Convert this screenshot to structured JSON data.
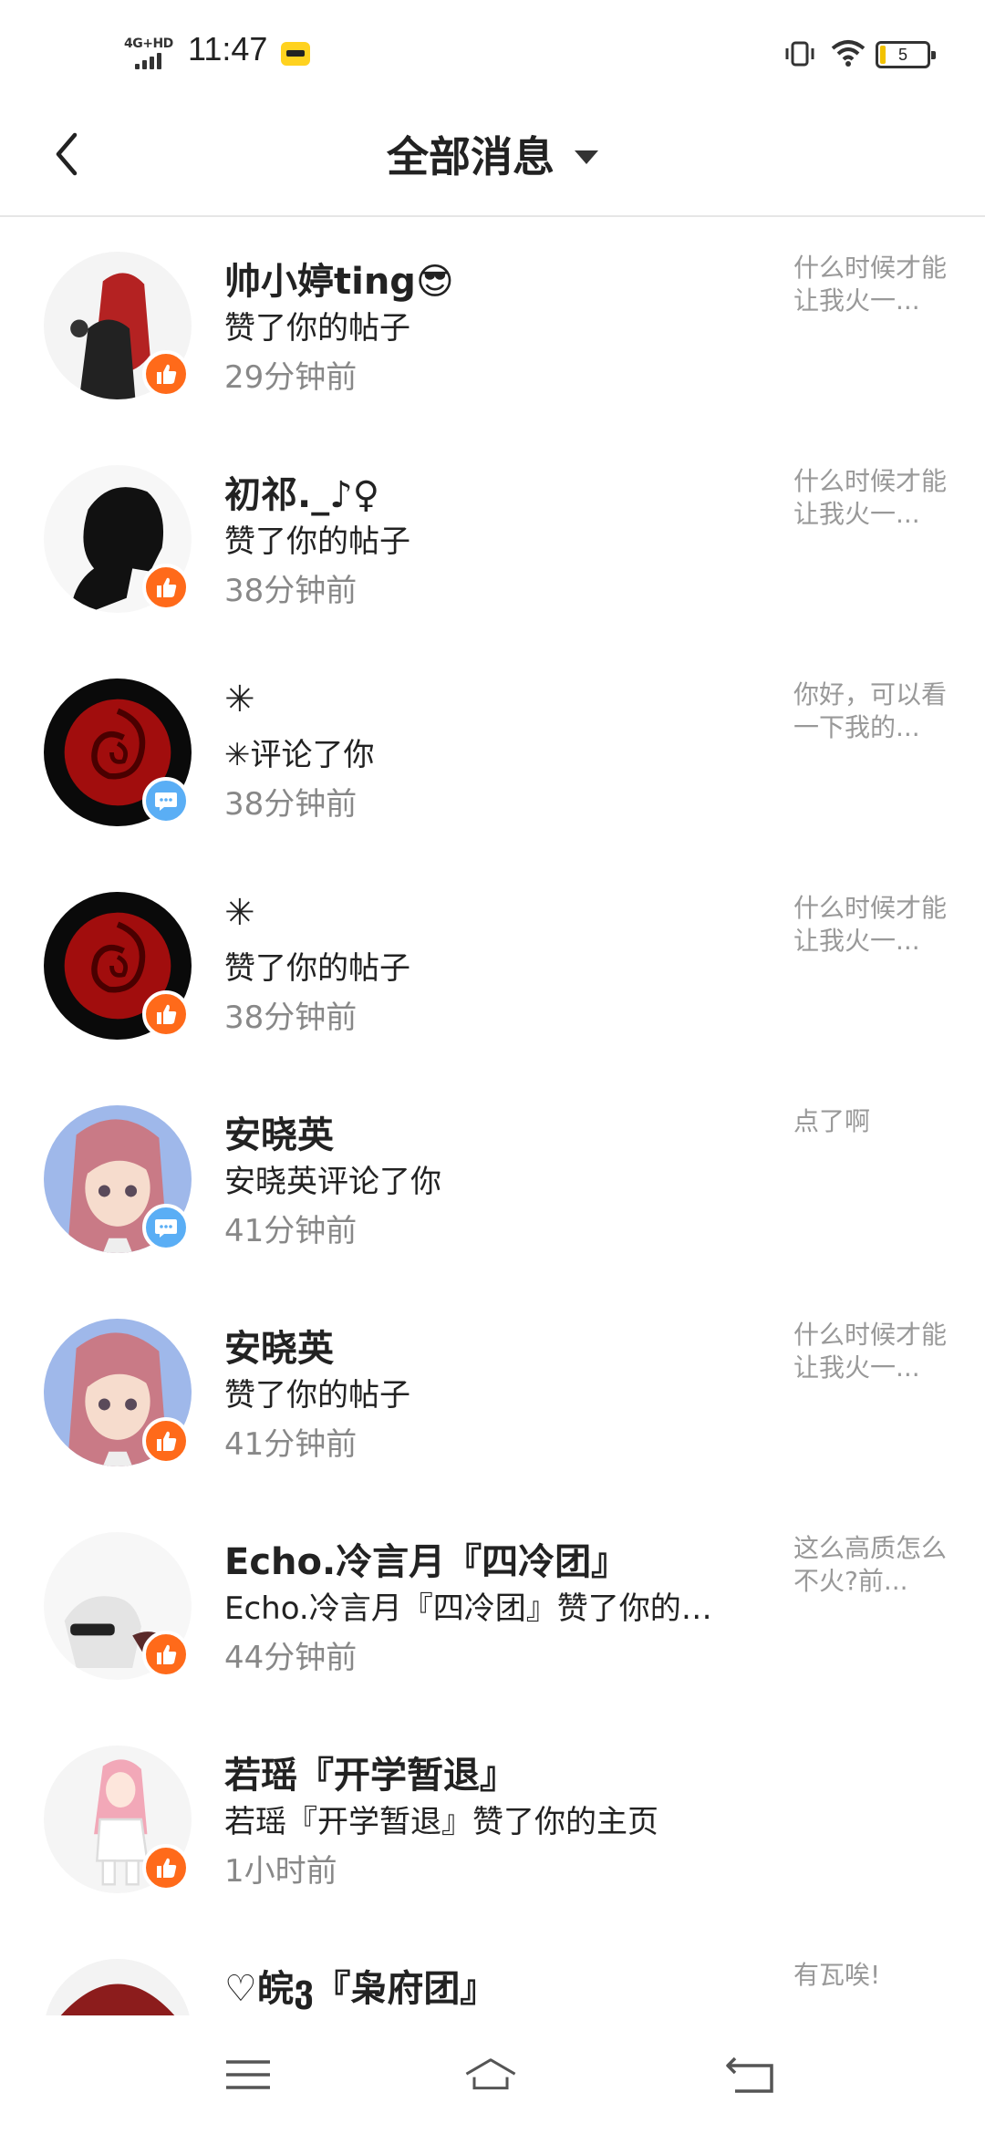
{
  "status_bar": {
    "network": "4G+HD",
    "time": "11:47",
    "battery": "5"
  },
  "header": {
    "title": "全部消息"
  },
  "colors": {
    "like_badge": "#ff6a1a",
    "comment_badge": "#5aaef5",
    "secondary_text": "#888888"
  },
  "messages": [
    {
      "name": "帅小婷ting😎",
      "action": "赞了你的帖子",
      "time": "29分钟前",
      "preview": "什么时候才能让我火一...",
      "badge": "like-icon"
    },
    {
      "name": "初祁._♪♀",
      "action": "赞了你的帖子",
      "time": "38分钟前",
      "preview": "什么时候才能让我火一...",
      "badge": "like-icon"
    },
    {
      "name": "✳",
      "action": "✳评论了你",
      "time": "38分钟前",
      "preview": "你好，可以看一下我的...",
      "badge": "comment-icon"
    },
    {
      "name": "✳",
      "action": "赞了你的帖子",
      "time": "38分钟前",
      "preview": "什么时候才能让我火一...",
      "badge": "like-icon"
    },
    {
      "name": "安晓英",
      "action": "安晓英评论了你",
      "time": "41分钟前",
      "preview": "点了啊",
      "badge": "comment-icon"
    },
    {
      "name": "安晓英",
      "action": "赞了你的帖子",
      "time": "41分钟前",
      "preview": "什么时候才能让我火一...",
      "badge": "like-icon"
    },
    {
      "name": "Echo.冷言月『四冷团』",
      "action": "Echo.冷言月『四冷团』赞了你的…",
      "time": "44分钟前",
      "preview": "这么高质怎么不火?前...",
      "badge": "like-icon"
    },
    {
      "name": "若瑶『开学暂退』",
      "action": "若瑶『开学暂退』赞了你的主页",
      "time": "1小时前",
      "preview": "",
      "badge": "like-icon"
    },
    {
      "name": "♡皖ვ『枭府团』",
      "action": "",
      "time": "",
      "preview": "有瓦唉!",
      "badge": "like-icon"
    }
  ]
}
